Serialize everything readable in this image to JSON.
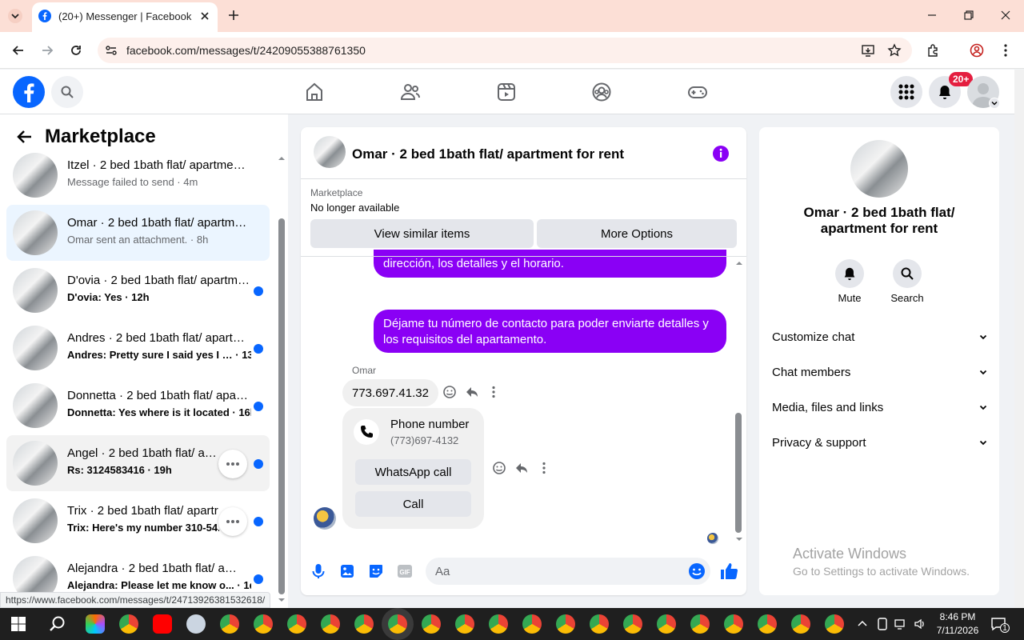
{
  "browser": {
    "tab_title": "(20+) Messenger | Facebook",
    "url": "facebook.com/messages/t/24209055388761350",
    "status_url": "https://www.facebook.com/messages/t/24713926381532618/"
  },
  "topbar": {
    "notification_badge": "20+"
  },
  "sidebar": {
    "title": "Marketplace",
    "conversations": [
      {
        "name": "Itzel · 2 bed 1bath flat/ apartment for rent",
        "preview": "Message failed to send · 4m",
        "unread": false
      },
      {
        "name": "Omar · 2 bed 1bath flat/ apartment for rent",
        "preview": "Omar sent an attachment. · 8h",
        "unread": false
      },
      {
        "name": "D'ovia · 2 bed 1bath flat/ apartment for rent",
        "preview": "D'ovia: Yes · 12h",
        "unread": true
      },
      {
        "name": "Andres · 2 bed 1bath flat/ apartment for rent",
        "preview": "Andres: Pretty sure I said yes I … · 13h",
        "unread": true
      },
      {
        "name": "Donnetta · 2 bed 1bath flat/ apartment for rent",
        "preview": "Donnetta: Yes where is it located · 16h",
        "unread": true
      },
      {
        "name": "Angel · 2 bed 1bath flat/ apar",
        "preview": "Rs: 3124583416 · 19h",
        "unread": true
      },
      {
        "name": "Trix · 2 bed 1bath flat/ apartr",
        "preview": "Trix: Here's my number 310-54...",
        "unread": true
      },
      {
        "name": "Alejandra · 2 bed 1bath flat/ apartment for rent",
        "preview": "Alejandra: Please let me know o... · 1d",
        "unread": true
      }
    ]
  },
  "chat": {
    "title": "Omar · 2 bed 1bath flat/ apartment for rent",
    "marketplace_label": "Marketplace",
    "listing_status": "No longer available",
    "btn_similar": "View similar items",
    "btn_more": "More Options",
    "msg1": "dirección, los detalles y el horario.",
    "msg2": "Déjame tu número de contacto para poder enviarte detalles y los requisitos del apartamento.",
    "sender": "Omar",
    "msg3": "773.697.41.32",
    "card_title": "Phone number",
    "card_number": "(773)697-4132",
    "btn_whatsapp": "WhatsApp call",
    "btn_call": "Call",
    "composer_placeholder": "Aa"
  },
  "details": {
    "title": "Omar · 2 bed 1bath flat/ apartment for rent",
    "mute": "Mute",
    "search": "Search",
    "rows": [
      "Customize chat",
      "Chat members",
      "Media, files and links",
      "Privacy & support"
    ]
  },
  "watermark": {
    "line1": "Activate Windows",
    "line2": "Go to Settings to activate Windows."
  },
  "taskbar": {
    "time": "8:46 PM",
    "date": "7/11/2026",
    "notif_count": "1"
  },
  "colors": {
    "fb_blue": "#0866ff",
    "bubble_purple": "#8a00f5",
    "badge_red": "#e41e3f"
  }
}
